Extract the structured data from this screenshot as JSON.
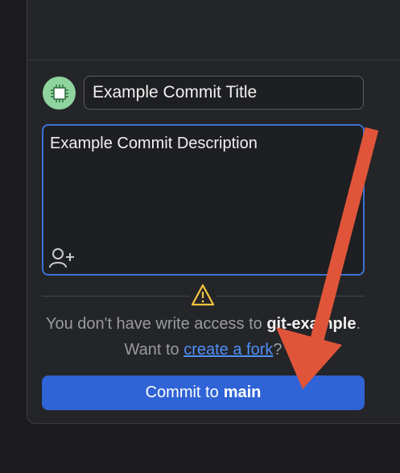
{
  "commit_panel": {
    "title_value": "Example Commit Title",
    "description_value": "Example Commit Description",
    "notice": {
      "prefix": "You don't have write access to ",
      "repo_name": "git-example",
      "middle": ". Want to ",
      "link_text": "create a fork",
      "suffix": "?"
    },
    "commit_button": {
      "label": "Commit to",
      "branch": "main"
    }
  },
  "icons": {
    "avatar": "chip-avatar-icon",
    "add_coauthor": "add-person-icon",
    "warning": "warning-triangle-icon"
  },
  "colors": {
    "accent": "#2f63d6",
    "focus_border": "#3c72d6",
    "link": "#4f8ff7",
    "warning": "#f5c542",
    "avatar_bg": "#8fd49e",
    "annotation_arrow": "#e0553a"
  }
}
